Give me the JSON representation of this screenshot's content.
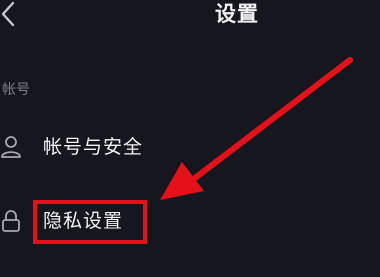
{
  "header": {
    "title": "设置",
    "back_icon": "chevron-left-icon"
  },
  "section": {
    "label": "帐号"
  },
  "items": [
    {
      "label": "帐号与安全",
      "icon": "user-icon"
    },
    {
      "label": "隐私设置",
      "icon": "lock-icon"
    }
  ],
  "annotation": {
    "color": "#e6101b",
    "shapes": [
      "arrow",
      "highlight-box"
    ]
  },
  "colors": {
    "background": "#16161f",
    "text": "#f4f4f6",
    "muted": "#7d7d86"
  }
}
